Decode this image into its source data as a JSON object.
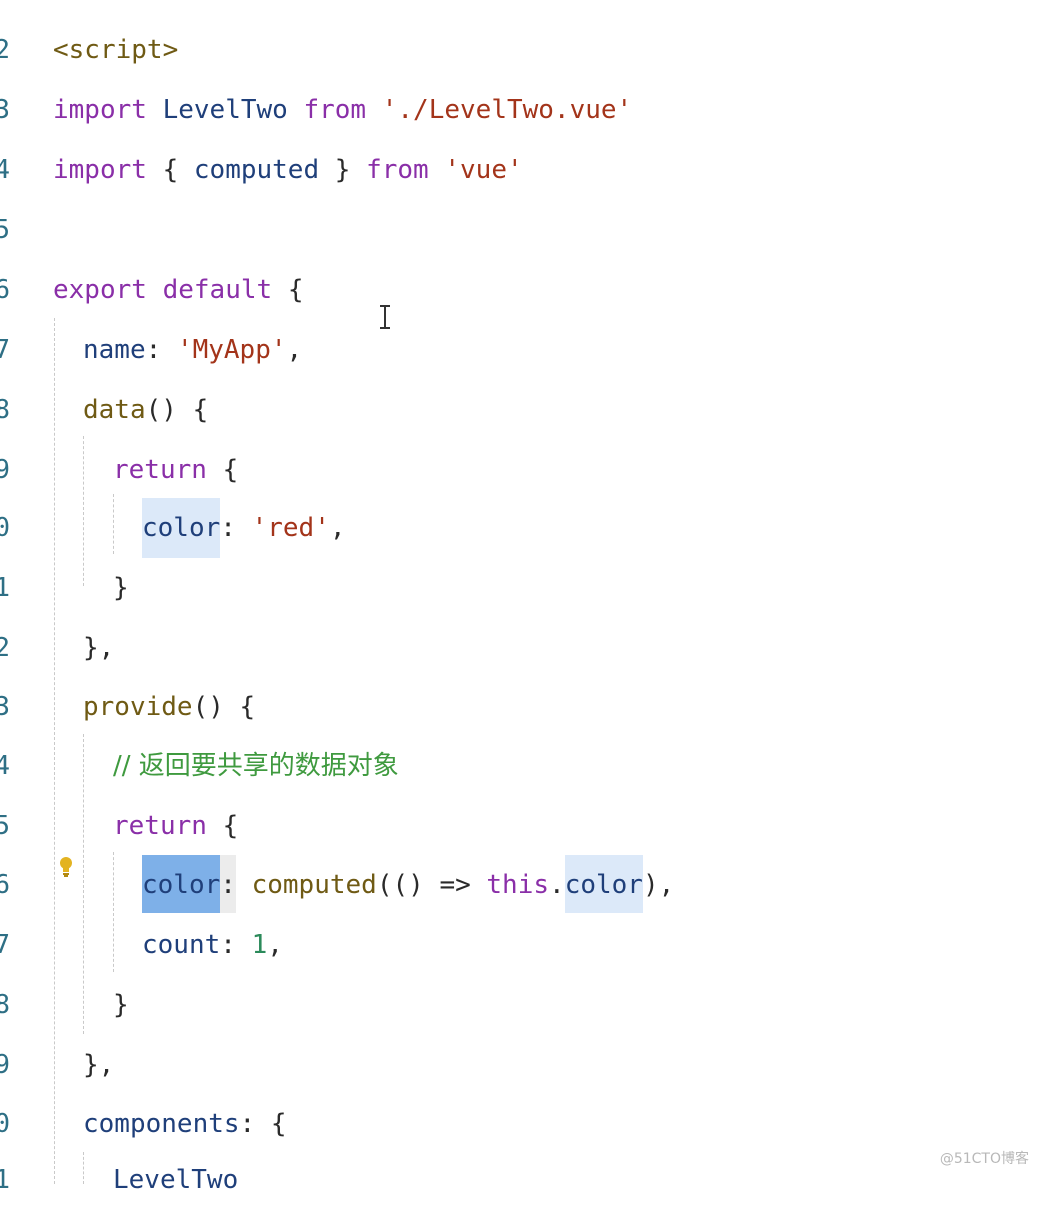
{
  "lines": [
    {
      "n": "2"
    },
    {
      "n": "3"
    },
    {
      "n": "4"
    },
    {
      "n": "5"
    },
    {
      "n": "6"
    },
    {
      "n": "7"
    },
    {
      "n": "8"
    },
    {
      "n": "9"
    },
    {
      "n": "0"
    },
    {
      "n": "1"
    },
    {
      "n": "2"
    },
    {
      "n": "3"
    },
    {
      "n": "4"
    },
    {
      "n": "5"
    },
    {
      "n": "6"
    },
    {
      "n": "7"
    },
    {
      "n": "8"
    },
    {
      "n": "9"
    },
    {
      "n": "0"
    },
    {
      "n": "1"
    }
  ],
  "tokens": {
    "script_tag": "<script>",
    "import": "import",
    "LevelTwo": "LevelTwo",
    "from": "from",
    "leveltwo_path": "'./LevelTwo.vue'",
    "brace_open_computed": "{ ",
    "computed": "computed",
    "brace_close_sp": " }",
    "vue_str": "'vue'",
    "export": "export",
    "default": "default",
    "brace_open": "{",
    "name": "name",
    "colon": ":",
    "myapp_str": "'MyApp'",
    "comma": ",",
    "data": "data",
    "parens": "()",
    "return": "return",
    "color": "color",
    "red_str": "'red'",
    "brace_close": "}",
    "brace_close_comma": "},",
    "provide": "provide",
    "comment": "// 返回要共享的数据对象",
    "computed_call": "computed",
    "arrow_args": "(() => ",
    "this": "this",
    "dot": ".",
    "close_paren_comma": "),",
    "count": "count",
    "one": "1",
    "components": "components",
    "leveltwo_partial": "LevelTwo"
  },
  "watermark": "@51CTO博客",
  "icons": [
    "lightbulb-icon",
    "text-cursor-icon"
  ]
}
